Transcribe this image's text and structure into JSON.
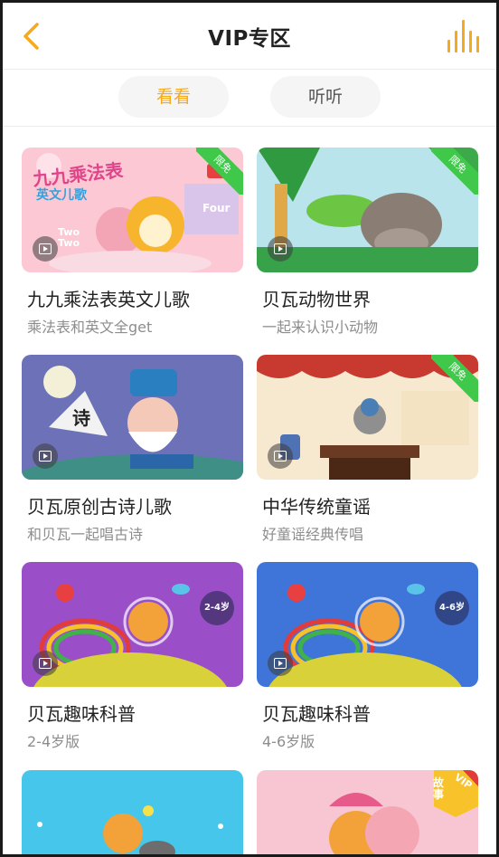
{
  "header": {
    "title": "VIP专区"
  },
  "tabs": [
    {
      "label": "看看",
      "active": true
    },
    {
      "label": "听听",
      "active": false
    }
  ],
  "colors": {
    "accent": "#f6a91d",
    "badge": "#3fc84a"
  },
  "cards": [
    {
      "title": "九九乘法表英文儿歌",
      "subtitle": "乘法表和英文全get",
      "badge": "限免",
      "thumb_text": [
        "九九乘法表",
        "英文儿歌",
        "Two Two",
        "Four"
      ]
    },
    {
      "title": "贝瓦动物世界",
      "subtitle": "一起来认识小动物",
      "badge": "限免"
    },
    {
      "title": "贝瓦原创古诗儿歌",
      "subtitle": "和贝瓦一起唱古诗",
      "badge": "",
      "thumb_text": [
        "诗"
      ]
    },
    {
      "title": "中华传统童谣",
      "subtitle": "好童谣经典传唱",
      "badge": "限免"
    },
    {
      "title": "贝瓦趣味科普",
      "subtitle": "2-4岁版",
      "badge": "",
      "age": "2-4岁"
    },
    {
      "title": "贝瓦趣味科普",
      "subtitle": "4-6岁版",
      "badge": "",
      "age": "4-6岁"
    },
    {
      "title": "",
      "subtitle": "",
      "badge": ""
    },
    {
      "title": "",
      "subtitle": "",
      "badge": "VIP",
      "thumb_text": [
        "故事"
      ]
    }
  ]
}
